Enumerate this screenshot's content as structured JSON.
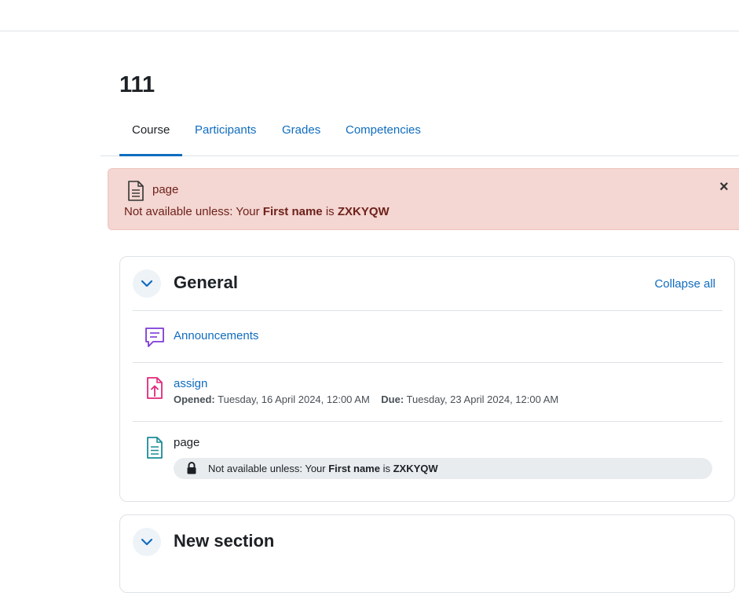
{
  "course": {
    "title": "111"
  },
  "tabs": [
    {
      "label": "Course",
      "active": true
    },
    {
      "label": "Participants",
      "active": false
    },
    {
      "label": "Grades",
      "active": false
    },
    {
      "label": "Competencies",
      "active": false
    }
  ],
  "alert": {
    "activity_name": "page",
    "restriction_prefix": "Not available unless: Your ",
    "field_name": "First name",
    "connector": " is ",
    "value": "ZXKYQW",
    "close_label": "×",
    "background": "#f4d6d2"
  },
  "sections": [
    {
      "title": "General",
      "collapse_all_label": "Collapse all",
      "activities": [
        {
          "name": "Announcements",
          "icon": "forum-icon",
          "color": "#7f3ad6"
        },
        {
          "name": "assign",
          "icon": "assignment-upload-icon",
          "color": "#e0297a",
          "opened_label": "Opened:",
          "opened_value": "Tuesday, 16 April 2024, 12:00 AM",
          "due_label": "Due:",
          "due_value": "Tuesday, 23 April 2024, 12:00 AM"
        },
        {
          "name": "page",
          "icon": "page-icon",
          "color": "#1a8c96",
          "restriction_prefix": "Not available unless: Your ",
          "field_name": "First name",
          "connector": " is ",
          "value": "ZXKYQW"
        }
      ]
    },
    {
      "title": "New section"
    }
  ],
  "colors": {
    "link": "#0f6cbf",
    "text": "#1d2125"
  }
}
